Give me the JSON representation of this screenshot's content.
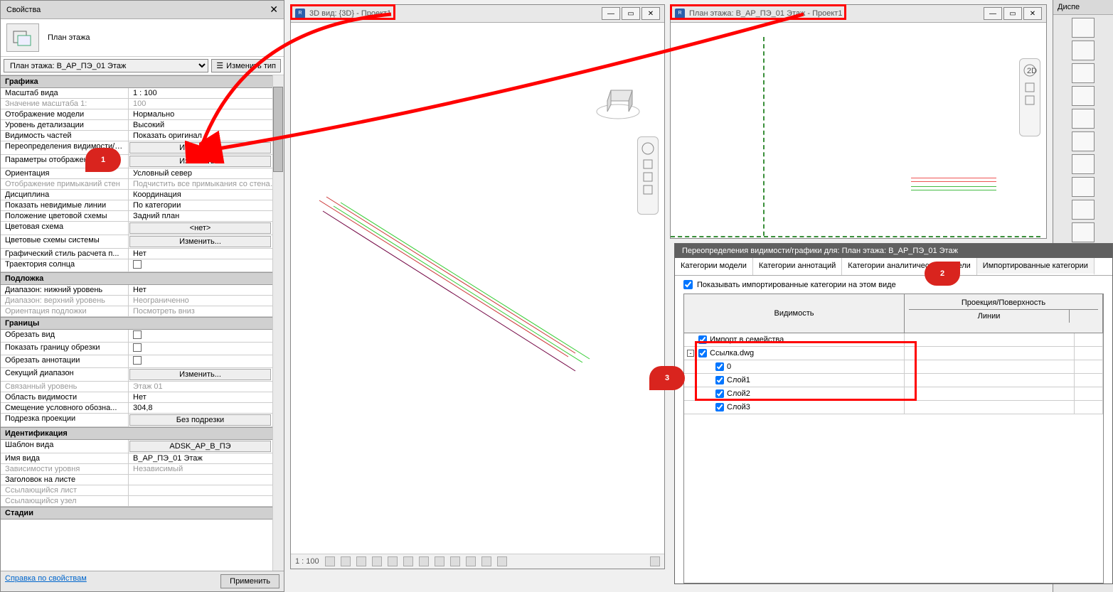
{
  "properties": {
    "title": "Свойства",
    "plan_label": "План этажа",
    "type_selector": "План этажа: В_АР_ПЭ_01 Этаж",
    "edit_type": "Изменить тип",
    "help_link": "Справка по свойствам",
    "apply_btn": "Применить",
    "groups": [
      {
        "name": "Графика",
        "rows": [
          {
            "n": "Масштаб вида",
            "v": "1 : 100"
          },
          {
            "n": "Значение масштаба   1:",
            "v": "100",
            "d": true
          },
          {
            "n": "Отображение модели",
            "v": "Нормально"
          },
          {
            "n": "Уровень детализации",
            "v": "Высокий"
          },
          {
            "n": "Видимость частей",
            "v": "Показать оригинал"
          },
          {
            "n": "Переопределения видимости/графики",
            "v": "Изменить...",
            "btn": true
          },
          {
            "n": "Параметры отображения графики",
            "v": "Изменить...",
            "btn": true
          },
          {
            "n": "Ориентация",
            "v": "Условный север"
          },
          {
            "n": "Отображение примыканий стен",
            "v": "Подчистить все примыкания со стенами",
            "d": true
          },
          {
            "n": "Дисциплина",
            "v": "Координация"
          },
          {
            "n": "Показать невидимые линии",
            "v": "По категории"
          },
          {
            "n": "Положение цветовой схемы",
            "v": "Задний план"
          },
          {
            "n": "Цветовая схема",
            "v": "<нет>",
            "btn": true
          },
          {
            "n": "Цветовые схемы системы",
            "v": "Изменить...",
            "btn": true
          },
          {
            "n": "Графический стиль расчета п...",
            "v": "Нет"
          },
          {
            "n": "Траектория солнца",
            "v": "",
            "chk": true
          }
        ]
      },
      {
        "name": "Подложка",
        "rows": [
          {
            "n": "Диапазон: нижний уровень",
            "v": "Нет"
          },
          {
            "n": "Диапазон: верхний уровень",
            "v": "Неограниченно",
            "d": true
          },
          {
            "n": "Ориентация подложки",
            "v": "Посмотреть вниз",
            "d": true
          }
        ]
      },
      {
        "name": "Границы",
        "rows": [
          {
            "n": "Обрезать вид",
            "v": "",
            "chk": true
          },
          {
            "n": "Показать границу обрезки",
            "v": "",
            "chk": true
          },
          {
            "n": "Обрезать аннотации",
            "v": "",
            "chk": true
          },
          {
            "n": "Секущий диапазон",
            "v": "Изменить...",
            "btn": true
          },
          {
            "n": "Связанный уровень",
            "v": "Этаж 01",
            "d": true
          },
          {
            "n": "Область видимости",
            "v": "Нет"
          },
          {
            "n": "Смещение условного обозна...",
            "v": "304,8"
          },
          {
            "n": "Подрезка проекции",
            "v": "Без подрезки",
            "btn": true
          }
        ]
      },
      {
        "name": "Идентификация",
        "rows": [
          {
            "n": "Шаблон вида",
            "v": "ADSK_АР_В_ПЭ",
            "btn": true
          },
          {
            "n": "Имя вида",
            "v": "В_АР_ПЭ_01 Этаж"
          },
          {
            "n": "Зависимости уровня",
            "v": "Независимый",
            "d": true
          },
          {
            "n": "Заголовок на листе",
            "v": ""
          },
          {
            "n": "Ссылающийся лист",
            "v": "",
            "d": true
          },
          {
            "n": "Ссылающийся узел",
            "v": "",
            "d": true
          }
        ]
      },
      {
        "name": "Стадии",
        "rows": []
      }
    ]
  },
  "view3d": {
    "title": "3D вид: {3D} - Проект1",
    "scale": "1 : 100"
  },
  "viewplan": {
    "title": "План этажа: В_АР_ПЭ_01 Этаж - Проект1"
  },
  "dispatcher": {
    "title": "Диспе"
  },
  "dialog": {
    "title": "Переопределения видимости/графики для: План этажа: В_АР_ПЭ_01 Этаж",
    "tabs": [
      "Категории модели",
      "Категории аннотаций",
      "Категории аналитической модели",
      "Импортированные категории"
    ],
    "active_tab": 3,
    "show_chk": "Показывать импортированные категории на этом виде",
    "cols": {
      "visibility": "Видимость",
      "proj": "Проекция/Поверхность",
      "lines": "Линии"
    },
    "rows": [
      {
        "label": "Импорт в семейства",
        "indent": 0,
        "exp": null
      },
      {
        "label": "Ссылка.dwg",
        "indent": 0,
        "exp": "-"
      },
      {
        "label": "0",
        "indent": 1
      },
      {
        "label": "Слой1",
        "indent": 1
      },
      {
        "label": "Слой2",
        "indent": 1
      },
      {
        "label": "Слой3",
        "indent": 1
      }
    ]
  },
  "callouts": {
    "c1": "1",
    "c2": "2",
    "c3": "3"
  }
}
